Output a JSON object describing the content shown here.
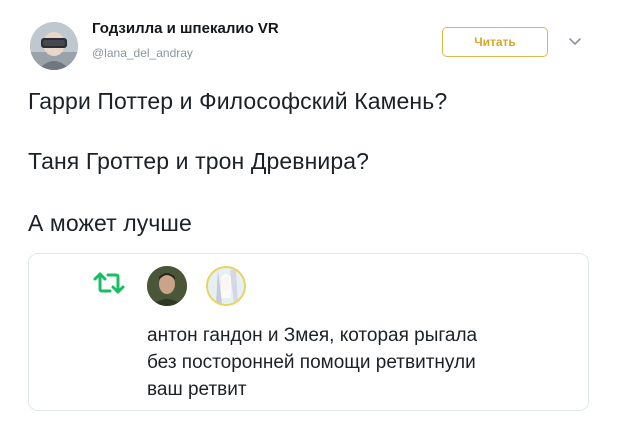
{
  "header": {
    "display_name": "Годзилла и шпекалио VR",
    "handle": "@lana_del_andray",
    "follow_label": "Читать"
  },
  "tweet": {
    "lines": [
      "Гарри Поттер и Философский Камень?",
      "Таня Гроттер и трон Древнира?",
      "А может лучше"
    ]
  },
  "card": {
    "notification_lines": [
      "антон гандон и Змея, которая рыгала",
      "без посторонней помощи ретвитнули",
      "ваш ретвит"
    ]
  },
  "colors": {
    "follow_accent": "#d9a728",
    "retweet_green": "#17bf63",
    "handle_gray": "#8a959e"
  },
  "icons": {
    "chevron": "chevron-down-icon",
    "retweet": "retweet-icon"
  }
}
